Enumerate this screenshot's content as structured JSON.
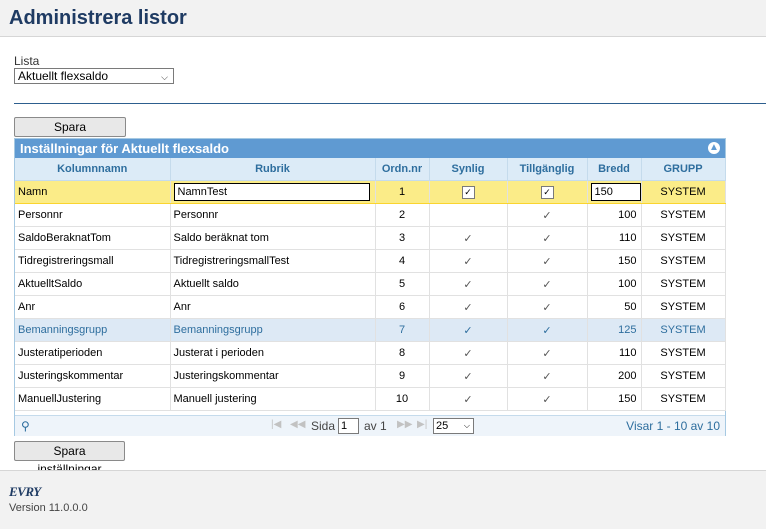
{
  "page": {
    "title": "Administrera listor"
  },
  "lista": {
    "label": "Lista",
    "selected": "Aktuellt flexsaldo"
  },
  "buttons": {
    "save_top": "Spara inställningar",
    "save_bottom": "Spara inställningar"
  },
  "grid": {
    "title": "Inställningar för Aktuellt flexsaldo",
    "columns": [
      "Kolumnnamn",
      "Rubrik",
      "Ordn.nr",
      "Synlig",
      "Tillgänglig",
      "Bredd",
      "GRUPP"
    ],
    "rows": [
      {
        "name": "Namn",
        "rubrik": "NamnTest",
        "ord": "1",
        "synlig": "✓",
        "tillganglig": "✓",
        "bredd": "150",
        "grupp": "SYSTEM"
      },
      {
        "name": "Personnr",
        "rubrik": "Personnr",
        "ord": "2",
        "synlig": "",
        "tillganglig": "✓",
        "bredd": "100",
        "grupp": "SYSTEM"
      },
      {
        "name": "SaldoBeraknatTom",
        "rubrik": "Saldo beräknat tom",
        "ord": "3",
        "synlig": "✓",
        "tillganglig": "✓",
        "bredd": "110",
        "grupp": "SYSTEM"
      },
      {
        "name": "Tidregistreringsmall",
        "rubrik": "TidregistreringsmallTest",
        "ord": "4",
        "synlig": "✓",
        "tillganglig": "✓",
        "bredd": "150",
        "grupp": "SYSTEM"
      },
      {
        "name": "AktuelltSaldo",
        "rubrik": "Aktuellt saldo",
        "ord": "5",
        "synlig": "✓",
        "tillganglig": "✓",
        "bredd": "100",
        "grupp": "SYSTEM"
      },
      {
        "name": "Anr",
        "rubrik": "Anr",
        "ord": "6",
        "synlig": "✓",
        "tillganglig": "✓",
        "bredd": "50",
        "grupp": "SYSTEM"
      },
      {
        "name": "Bemanningsgrupp",
        "rubrik": "Bemanningsgrupp",
        "ord": "7",
        "synlig": "✓",
        "tillganglig": "✓",
        "bredd": "125",
        "grupp": "SYSTEM"
      },
      {
        "name": "Justeratiperioden",
        "rubrik": "Justerat i perioden",
        "ord": "8",
        "synlig": "✓",
        "tillganglig": "✓",
        "bredd": "110",
        "grupp": "SYSTEM"
      },
      {
        "name": "Justeringskommentar",
        "rubrik": "Justeringskommentar",
        "ord": "9",
        "synlig": "✓",
        "tillganglig": "✓",
        "bredd": "200",
        "grupp": "SYSTEM"
      },
      {
        "name": "ManuellJustering",
        "rubrik": "Manuell justering",
        "ord": "10",
        "synlig": "✓",
        "tillganglig": "✓",
        "bredd": "150",
        "grupp": "SYSTEM"
      }
    ],
    "pager": {
      "sida_label": "Sida",
      "page": "1",
      "av_label": "av 1",
      "rows_per_page": "25",
      "info": "Visar 1 - 10 av 10"
    }
  },
  "footer": {
    "logo": "EVRY",
    "version": "Version 11.0.0.0"
  },
  "colors": {
    "header_text": "#1f3b63",
    "grid_title_bg": "#5f9ad2",
    "selected_row": "#fbec88",
    "hover_row": "#dde9f5"
  }
}
